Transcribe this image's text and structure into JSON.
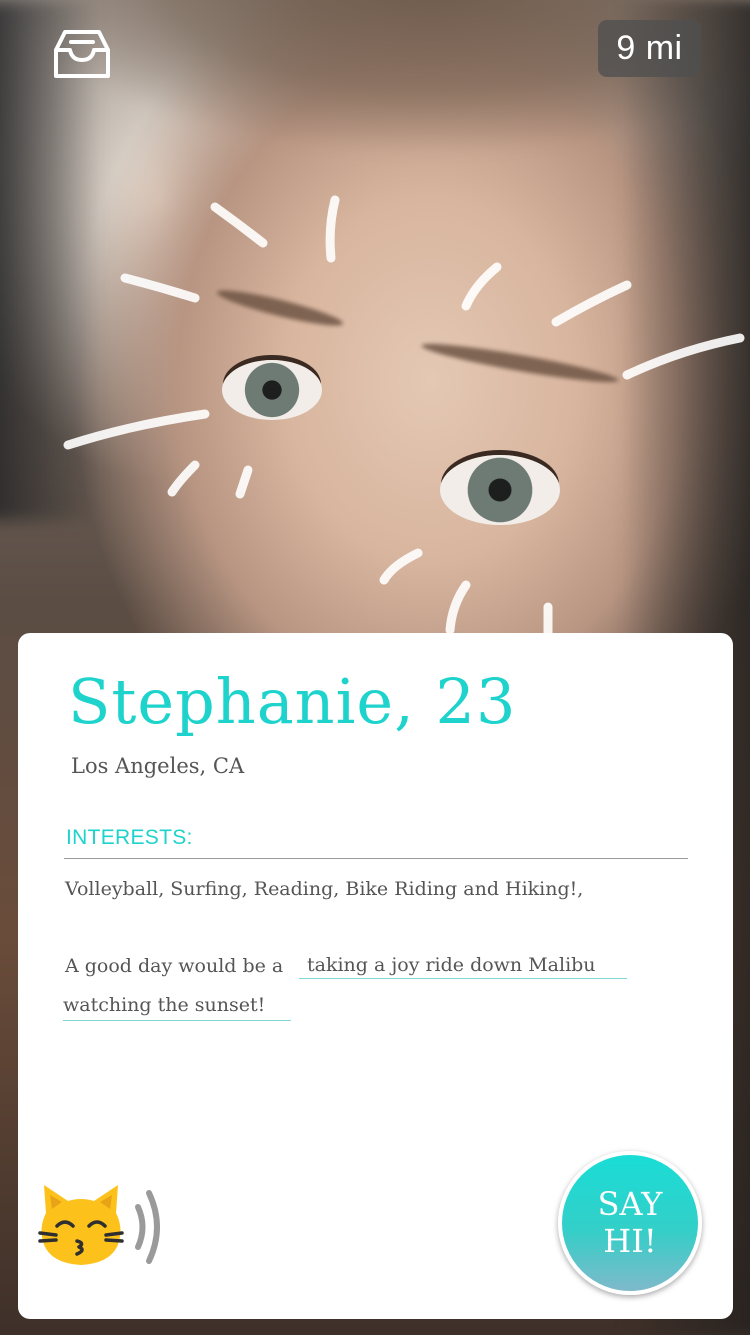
{
  "header": {
    "inbox_icon": "inbox-icon",
    "distance": "9 mi"
  },
  "profile": {
    "name_age": "Stephanie, 23",
    "location": "Los Angeles, CA",
    "interests_label": "INTERESTS:",
    "interests": "Volleyball, Surfing, Reading, Bike Riding and Hiking!,",
    "good_day_prefix": "A good day would be a",
    "good_day_line1": "taking a joy ride down Malibu",
    "good_day_line2": "watching the sunset!"
  },
  "actions": {
    "emoji_icon": "kissing-cat-icon",
    "sound_icon": "sound-waves-icon",
    "say_hi_line1": "SAY",
    "say_hi_line2": "HI!"
  },
  "colors": {
    "accent": "#1ed3cc",
    "card_bg": "#ffffff",
    "badge_bg": "#505050"
  }
}
